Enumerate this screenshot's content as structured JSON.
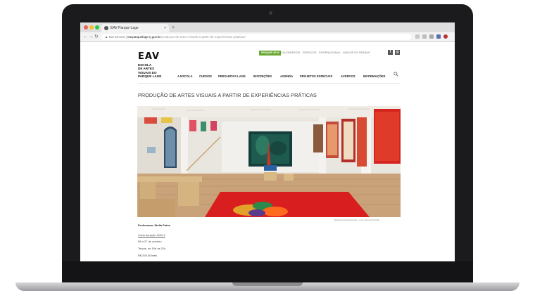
{
  "browser": {
    "tab_title": "EAV Parque Lage",
    "tab_close": "×",
    "new_tab": "+",
    "security_label": "Not Secure",
    "url_domain": "eavparquelage.rj.gov.br",
    "url_path": "/producao-de-artes-visuais-a-partir-de-experiencias-praticas/"
  },
  "site": {
    "logo_mark": "EAV",
    "logo_lines": [
      "ESCOLA",
      "DE ARTES",
      "VISUAIS DO",
      "PARQUE LAGE"
    ],
    "utility_nav": {
      "highlight": "PARQUE 2019",
      "items": [
        "CALENDÁRIOS",
        "SERVIÇOS",
        "INTERNACIONAL",
        "AMIGOS DO PARQUE"
      ]
    },
    "social": [
      "f",
      "◎"
    ],
    "main_nav": [
      "A ESCOLA",
      "CURSOS",
      "PERGUNTAS LAGE",
      "INSCRIÇÕES",
      "AGENDA",
      "PROJETOS ESPECIAIS",
      "ACERVOS",
      "INFORMAÇÕES"
    ]
  },
  "article": {
    "title": "PRODUÇÃO DE ARTES VISUAIS A PARTIR DE EXPERIÊNCIAS PRÁTICAS",
    "photo_caption": "Vista Retrospectiva Iniciais – Foto: Vanessa Portella",
    "teacher": "Professora: Stella Paiva",
    "course_link": "Curta duração 2020.2",
    "dates": "08 a 27 de outubro",
    "schedule": "Terças, de 19h às 21h",
    "price": "R$ 320,00/mês"
  },
  "colors": {
    "accent_green": "#6aa832",
    "laptop_body": "#1b1b1d",
    "gallery_floor_red": "#d81e1e"
  }
}
